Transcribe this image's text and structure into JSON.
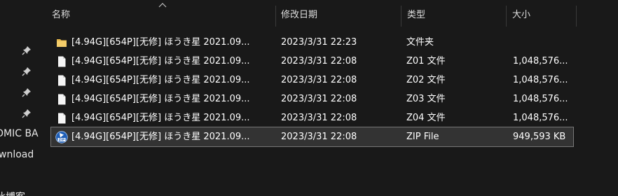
{
  "nav": {
    "items": [
      {
        "label": "OMIC BA"
      },
      {
        "label": "wnload"
      },
      {
        "label": "此博客"
      }
    ]
  },
  "columns": {
    "name": "名称",
    "date": "修改日期",
    "type": "类型",
    "size": "大小"
  },
  "files": [
    {
      "name": "[4.94G][654P][无修] ほうき星 2021.09...",
      "date": "2023/3/31 22:23",
      "type": "文件夹",
      "size": "",
      "icon": "folder-icon"
    },
    {
      "name": "[4.94G][654P][无修] ほうき星 2021.09...",
      "date": "2023/3/31 22:08",
      "type": "Z01 文件",
      "size": "1,048,576...",
      "icon": "file-icon"
    },
    {
      "name": "[4.94G][654P][无修] ほうき星 2021.09...",
      "date": "2023/3/31 22:08",
      "type": "Z02 文件",
      "size": "1,048,576...",
      "icon": "file-icon"
    },
    {
      "name": "[4.94G][654P][无修] ほうき星 2021.09...",
      "date": "2023/3/31 22:08",
      "type": "Z03 文件",
      "size": "1,048,576...",
      "icon": "file-icon"
    },
    {
      "name": "[4.94G][654P][无修] ほうき星 2021.09...",
      "date": "2023/3/31 22:08",
      "type": "Z04 文件",
      "size": "1,048,576...",
      "icon": "file-icon"
    },
    {
      "name": "[4.94G][654P][无修] ほうき星 2021.09...",
      "date": "2023/3/31 22:08",
      "type": "ZIP File",
      "size": "949,593 KB",
      "icon": "zip-icon"
    }
  ],
  "selected_index": 5,
  "colors": {
    "background": "#191919",
    "selection": "#333333",
    "folder": "#e8b84a"
  }
}
